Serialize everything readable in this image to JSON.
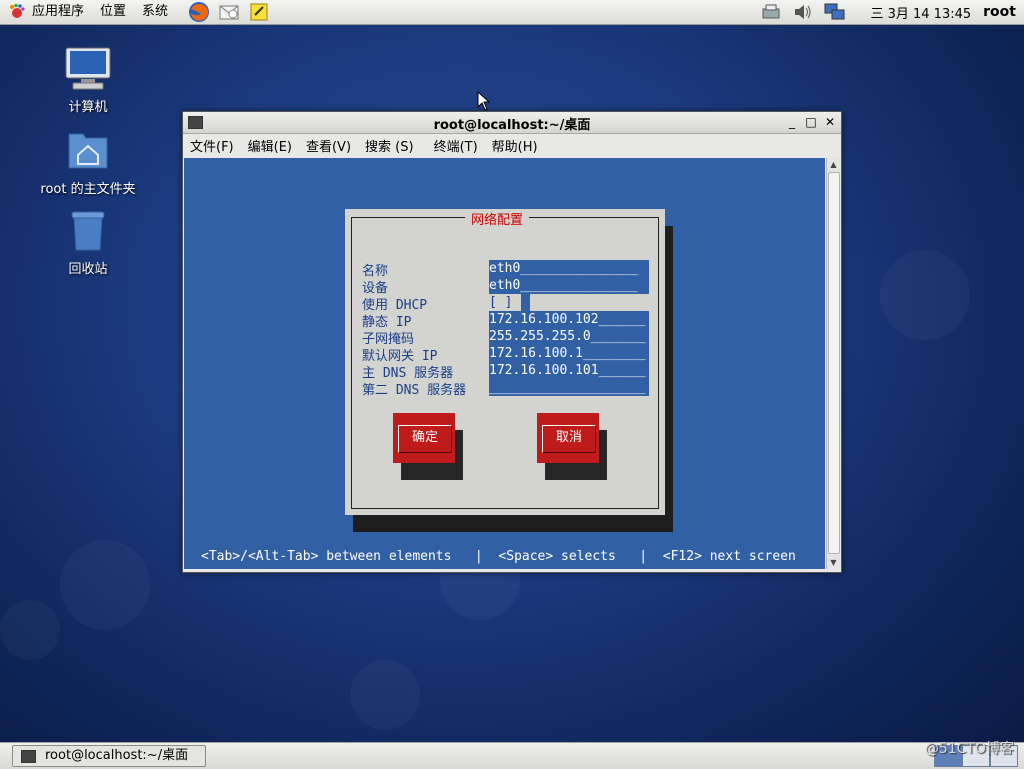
{
  "top_panel": {
    "menu": [
      "应用程序",
      "位置",
      "系统"
    ],
    "launchers": [
      "firefox-icon",
      "mail-icon",
      "notes-icon"
    ],
    "clock": "三 3月 14 13:45",
    "user": "root"
  },
  "desktop_icons": [
    {
      "label": "计算机",
      "icon": "computer-icon"
    },
    {
      "label": "root 的主文件夹",
      "icon": "home-folder-icon"
    },
    {
      "label": "回收站",
      "icon": "trash-icon"
    }
  ],
  "terminal": {
    "title": "root@localhost:~/桌面",
    "menu": [
      "文件(F)",
      "编辑(E)",
      "查看(V)",
      "搜索 (S)",
      "终端(T)",
      "帮助(H)"
    ]
  },
  "dialog": {
    "title": "网络配置",
    "fields": [
      {
        "label": "名称",
        "value": "eth0_______________"
      },
      {
        "label": "设备",
        "value": "eth0_______________"
      },
      {
        "label": "使用 DHCP",
        "value": "[ ]"
      },
      {
        "label": "静态 IP",
        "value": "172.16.100.102______"
      },
      {
        "label": "子网掩码",
        "value": "255.255.255.0_______"
      },
      {
        "label": "默认网关 IP",
        "value": "172.16.100.1________"
      },
      {
        "label": "主 DNS 服务器",
        "value": "172.16.100.101______"
      },
      {
        "label": "第二 DNS 服务器",
        "value": "____________________"
      }
    ],
    "ok": "确定",
    "cancel": "取消"
  },
  "hint": "<Tab>/<Alt-Tab> between elements   |  <Space> selects   |  <F12> next screen",
  "taskbar": {
    "window_button": "root@localhost:~/桌面"
  },
  "watermark": "@51CTO博客",
  "colors": {
    "terminal_bg": "#3160a4",
    "dialog_bg": "#d3d3cf",
    "button_red": "#bf1b1b",
    "dialog_title": "#cc0000"
  }
}
